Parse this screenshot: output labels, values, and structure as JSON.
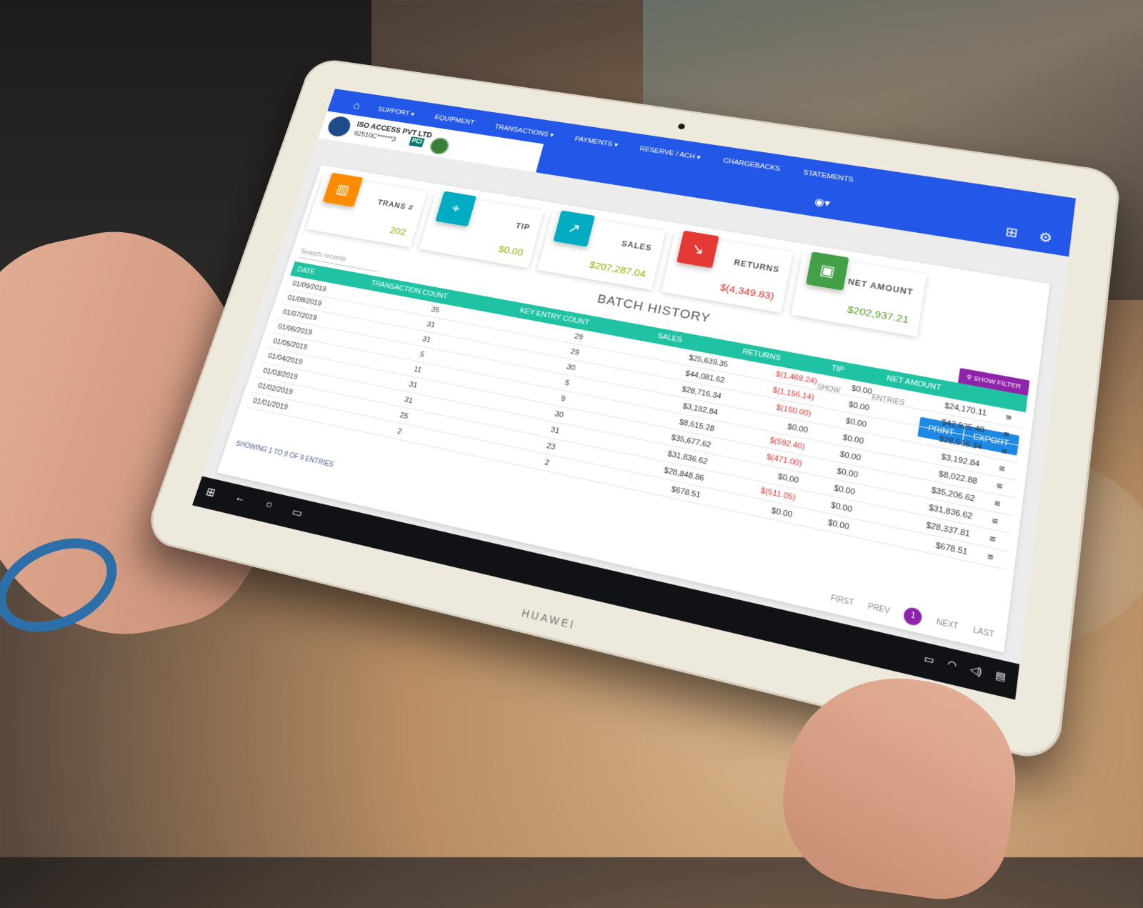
{
  "nav": {
    "items": [
      "SUPPORT ▾",
      "EQUIPMENT",
      "TRANSACTIONS ▾",
      "PAYMENTS ▾",
      "RESERVE / ACH ▾",
      "CHARGEBACKS",
      "STATEMENTS"
    ]
  },
  "merchant": {
    "name": "ISO ACCESS PVT LTD",
    "id": "92510C******3",
    "pci": "PCI"
  },
  "device": {
    "brand": "HUAWEI"
  },
  "stats": {
    "trans": {
      "label": "TRANS #",
      "value": "202"
    },
    "tip": {
      "label": "TIP",
      "value": "$0.00"
    },
    "sales": {
      "label": "SALES",
      "value": "$207,287.04"
    },
    "returns": {
      "label": "RETURNS",
      "value": "$(4,349.83)"
    },
    "net": {
      "label": "NET AMOUNT",
      "value": "$202,937.21"
    }
  },
  "page": {
    "title": "BATCH HISTORY",
    "search_placeholder": "Search records",
    "show_filter": "SHOW FILTER",
    "show": "SHOW",
    "entries": "ENTRIES",
    "print": "PRINT",
    "export": "EXPORT",
    "showing": "SHOWING 1 TO 9 OF 9 ENTRIES"
  },
  "table": {
    "headers": [
      "DATE",
      "TRANSACTION COUNT",
      "KEY ENTRY COUNT",
      "SALES",
      "RETURNS",
      "TIP",
      "NET AMOUNT"
    ],
    "rows": [
      [
        "01/09/2019",
        "35",
        "29",
        "$25,639.35",
        "$(1,469.24)",
        "$0.00",
        "$24,170.11"
      ],
      [
        "01/08/2019",
        "31",
        "29",
        "$44,081.62",
        "$(1,156.14)",
        "$0.00",
        "$42,925.48"
      ],
      [
        "01/07/2019",
        "31",
        "30",
        "$28,716.34",
        "$(150.00)",
        "$0.00",
        "$28,566.34"
      ],
      [
        "01/06/2019",
        "5",
        "5",
        "$3,192.84",
        "$0.00",
        "$0.00",
        "$3,192.84"
      ],
      [
        "01/05/2019",
        "11",
        "9",
        "$8,615.28",
        "$(592.40)",
        "$0.00",
        "$8,022.88"
      ],
      [
        "01/04/2019",
        "31",
        "30",
        "$35,677.62",
        "$(471.00)",
        "$0.00",
        "$35,206.62"
      ],
      [
        "01/03/2019",
        "31",
        "31",
        "$31,836.62",
        "$0.00",
        "$0.00",
        "$31,836.62"
      ],
      [
        "01/02/2019",
        "25",
        "23",
        "$28,848.86",
        "$(511.05)",
        "$0.00",
        "$28,337.81"
      ],
      [
        "01/01/2019",
        "2",
        "2",
        "$678.51",
        "$0.00",
        "$0.00",
        "$678.51"
      ]
    ]
  },
  "pager": {
    "first": "FIRST",
    "prev": "PREV",
    "current": "1",
    "next": "NEXT",
    "last": "LAST"
  },
  "colors": {
    "topbar": "#2357e8",
    "table_header": "#1fc3a4",
    "accent_purple": "#8e24aa",
    "button_blue": "#1e88e5"
  }
}
